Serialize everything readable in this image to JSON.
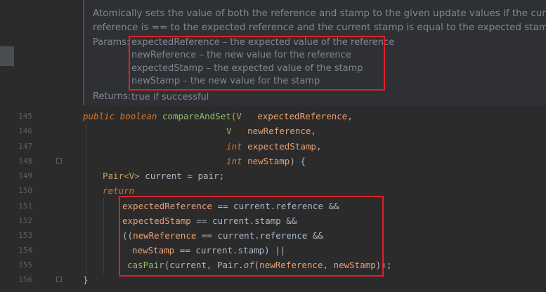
{
  "doc": {
    "line1": "Atomically sets the value of both the reference and stamp to the given update values if the current",
    "line2": "reference is == to the expected reference and the current stamp is equal to the expected stamp.",
    "params_label": "Params:",
    "params": [
      "expectedReference – the expected value of the reference",
      "newReference – the new value for the reference",
      "expectedStamp – the expected value of the stamp",
      "newStamp – the new value for the stamp"
    ],
    "returns_label": "Returns:",
    "returns_value": "true if successful"
  },
  "line_numbers": [
    "145",
    "146",
    "147",
    "148",
    "149",
    "150",
    "151",
    "152",
    "153",
    "154",
    "155",
    "156"
  ],
  "code": {
    "l145_public": "public",
    "l145_boolean": "boolean",
    "l145_method": "compareAndSet(",
    "l145_V": "V",
    "l145_param": "expectedReference",
    "l145_comma": ",",
    "l146_V": "V",
    "l146_param": "newReference",
    "l146_comma": ",",
    "l147_int": "int",
    "l147_param": "expectedStamp",
    "l147_comma": ",",
    "l148_int": "int",
    "l148_param": "newStamp",
    "l148_end": ") {",
    "l149_pair": "Pair",
    "l149_gen": "<V>",
    "l149_rest": " current = pair;",
    "l150_return": "return",
    "l151_a": "expectedReference",
    "l151_b": " == current.reference &&",
    "l152_a": "expectedStamp",
    "l152_b": " == current.stamp &&",
    "l153_a": "((",
    "l153_b": "newReference",
    "l153_c": " == current.reference &&",
    "l154_a": "newStamp",
    "l154_b": " == current.stamp) ||",
    "l155_a": "casPair",
    "l155_b": "(current, Pair.",
    "l155_c": "of",
    "l155_d": "(",
    "l155_e": "newReference",
    "l155_f": ", ",
    "l155_g": "newStamp",
    "l155_h": "));",
    "l156": "}"
  },
  "colors": {
    "background": "#2b2b2b",
    "highlight_box": "#e0202a",
    "keyword": "#cc7832",
    "parameter": "#e8a070",
    "method": "#8fbf6a",
    "doc_text": "#7f8793"
  }
}
